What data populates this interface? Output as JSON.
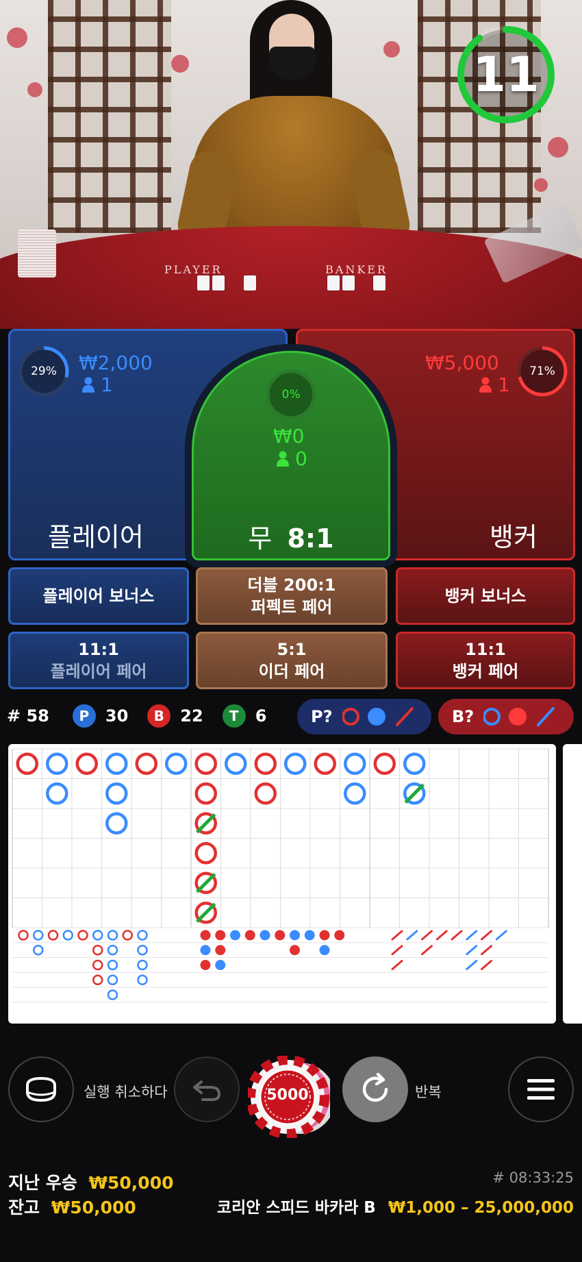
{
  "timer": {
    "seconds": "11",
    "progress": 0.9,
    "color": "#1fc93a"
  },
  "table": {
    "player_text": "PLAYER",
    "banker_text": "BANKER"
  },
  "bets": {
    "player": {
      "percent": "29%",
      "percent_value": 0.29,
      "amount": "₩2,000",
      "count": "1",
      "label": "플레이어",
      "color": "#2f64c7",
      "text_color": "#3a8cff"
    },
    "tie": {
      "percent": "0%",
      "percent_value": 0,
      "amount": "₩0",
      "count": "0",
      "label": "무",
      "odds": "8:1",
      "color": "#35c235",
      "text_color": "#3ae43a"
    },
    "banker": {
      "percent": "71%",
      "percent_value": 0.71,
      "amount": "₩5,000",
      "count": "1",
      "label": "뱅커",
      "color": "#e23131",
      "text_color": "#ff3b3b"
    }
  },
  "side_bets": {
    "player_bonus": {
      "line1": "플레이어 보너스"
    },
    "perfect_pair": {
      "line1": "더블 200:1",
      "line2": "퍼펙트 페어"
    },
    "banker_bonus": {
      "line1": "뱅커 보너스"
    },
    "player_pair": {
      "line1": "11:1",
      "line2": "플레이어 페어"
    },
    "either_pair": {
      "line1": "5:1",
      "line2": "이더 페어"
    },
    "banker_pair": {
      "line1": "11:1",
      "line2": "뱅커 페어"
    }
  },
  "stats": {
    "total_label": "# 58",
    "player_letter": "P",
    "player_count": "30",
    "banker_letter": "B",
    "banker_count": "22",
    "tie_letter": "T",
    "tie_count": "6"
  },
  "predict": {
    "player_label": "P?",
    "banker_label": "B?"
  },
  "road": {
    "big_road_columns": [
      [
        "B"
      ],
      [
        "P",
        "P"
      ],
      [
        "B"
      ],
      [
        "P",
        "P",
        "P"
      ],
      [
        "B"
      ],
      [
        "P"
      ],
      [
        "B",
        "B",
        "T",
        "B",
        "T",
        "T"
      ],
      [
        "P"
      ],
      [
        "B",
        "B"
      ],
      [
        "P"
      ],
      [
        "B"
      ],
      [
        "P",
        "P"
      ],
      [
        "B"
      ],
      [
        "P",
        "T"
      ]
    ]
  },
  "controls": {
    "undo_label": "실행 취소하다",
    "repeat_label": "반복",
    "chip_value": "5000"
  },
  "footer": {
    "last_win_label": "지난 우승",
    "last_win_value": "₩50,000",
    "balance_label": "잔고",
    "balance_value": "₩50,000",
    "round_id": "# 08:33:25",
    "table_name": "코리안 스피드 바카라 B",
    "limits": "₩1,000 – 25,000,000"
  },
  "colors": {
    "player_blue": "#3a8cff",
    "banker_red": "#e23131",
    "tie_green": "#1fa83a",
    "gold": "#f5c518"
  }
}
